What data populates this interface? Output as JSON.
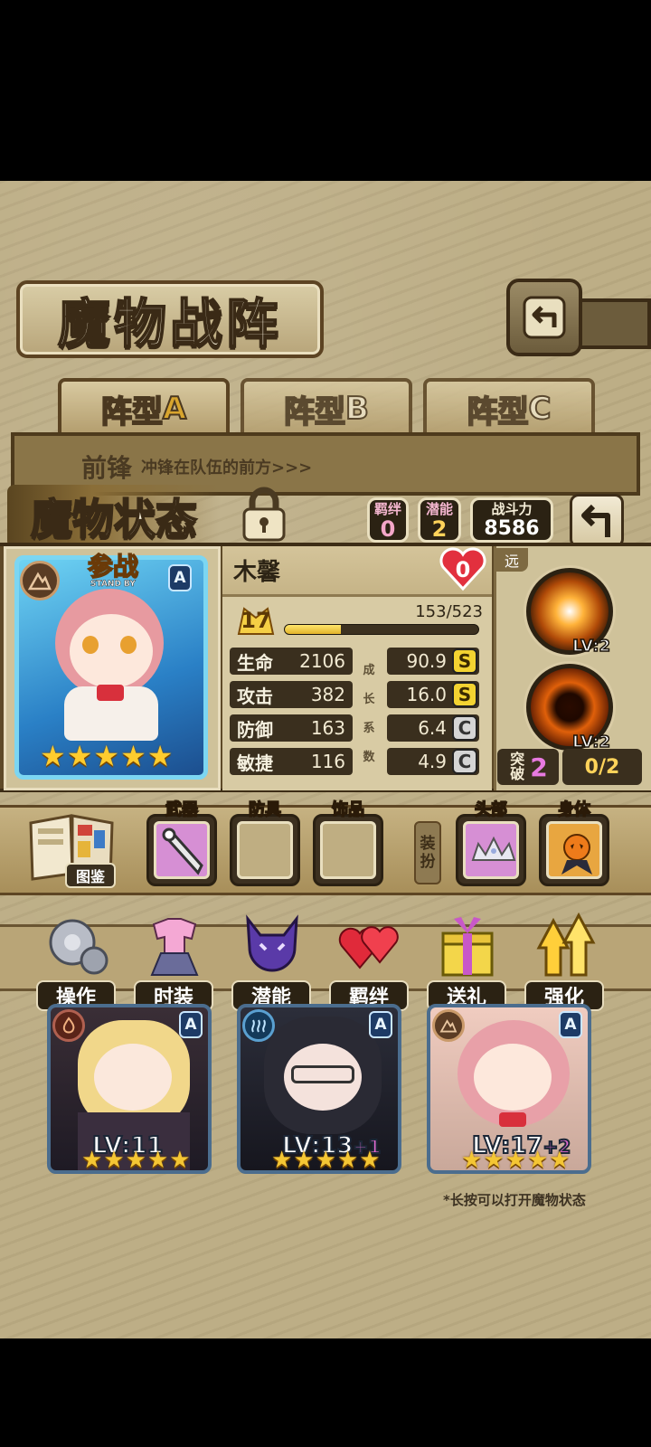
{
  "header": {
    "title": "魔物战阵"
  },
  "formation": {
    "tabs": [
      {
        "label": "阵型",
        "letter": "A"
      },
      {
        "label": "阵型",
        "letter": "B"
      },
      {
        "label": "阵型",
        "letter": "C"
      }
    ],
    "row_label": "前锋",
    "row_desc": "冲锋在队伍的前方>>>"
  },
  "status": {
    "title": "魔物状态",
    "bond_label": "羁绊",
    "bond_value": "0",
    "potential_label": "潜能",
    "potential_value": "2",
    "power_label": "战斗力",
    "power_value": "8586"
  },
  "monster": {
    "name": "木馨",
    "affection": "0",
    "level": "17",
    "exp_text": "153/523",
    "exp_fraction": 0.29,
    "standby_cn": "参战",
    "standby_en": "STAND BY",
    "rarity": "A",
    "stars": 5,
    "stats": [
      {
        "label": "生命",
        "value": "2106",
        "growth": "90.9",
        "grade": "S"
      },
      {
        "label": "攻击",
        "value": "382",
        "growth": "16.0",
        "grade": "S"
      },
      {
        "label": "防御",
        "value": "163",
        "growth": "6.4",
        "grade": "C"
      },
      {
        "label": "敏捷",
        "value": "116",
        "growth": "4.9",
        "grade": "C"
      }
    ],
    "growth_chars": [
      "成",
      "长",
      "系",
      "数"
    ],
    "range": "远",
    "skills": [
      {
        "lv": "LV:2"
      },
      {
        "lv": "LV:2"
      }
    ],
    "breakthrough_label": [
      "突",
      "破"
    ],
    "breakthrough_value": "2",
    "breakthrough_progress": "0/2"
  },
  "equipment": {
    "book_label": "图鉴",
    "slots": [
      "武器",
      "防具",
      "饰品",
      "头部",
      "身体"
    ],
    "decor_label": [
      "装",
      "扮"
    ]
  },
  "actions": [
    "操作",
    "时装",
    "潜能",
    "羁绊",
    "送礼",
    "强化"
  ],
  "team": [
    {
      "lv": "LV:11",
      "plus": "",
      "rarity": "A",
      "stars": 5
    },
    {
      "lv": "LV:13",
      "plus": "+1",
      "rarity": "A",
      "stars": 5
    },
    {
      "lv": "LV:17",
      "plus": "+2",
      "rarity": "A",
      "stars": 5
    }
  ],
  "footnote": "*长按可以打开魔物状态",
  "colors": {
    "gold": "#ffcc2e",
    "panel": "#5e4a28",
    "parchment": "#bdae86"
  }
}
